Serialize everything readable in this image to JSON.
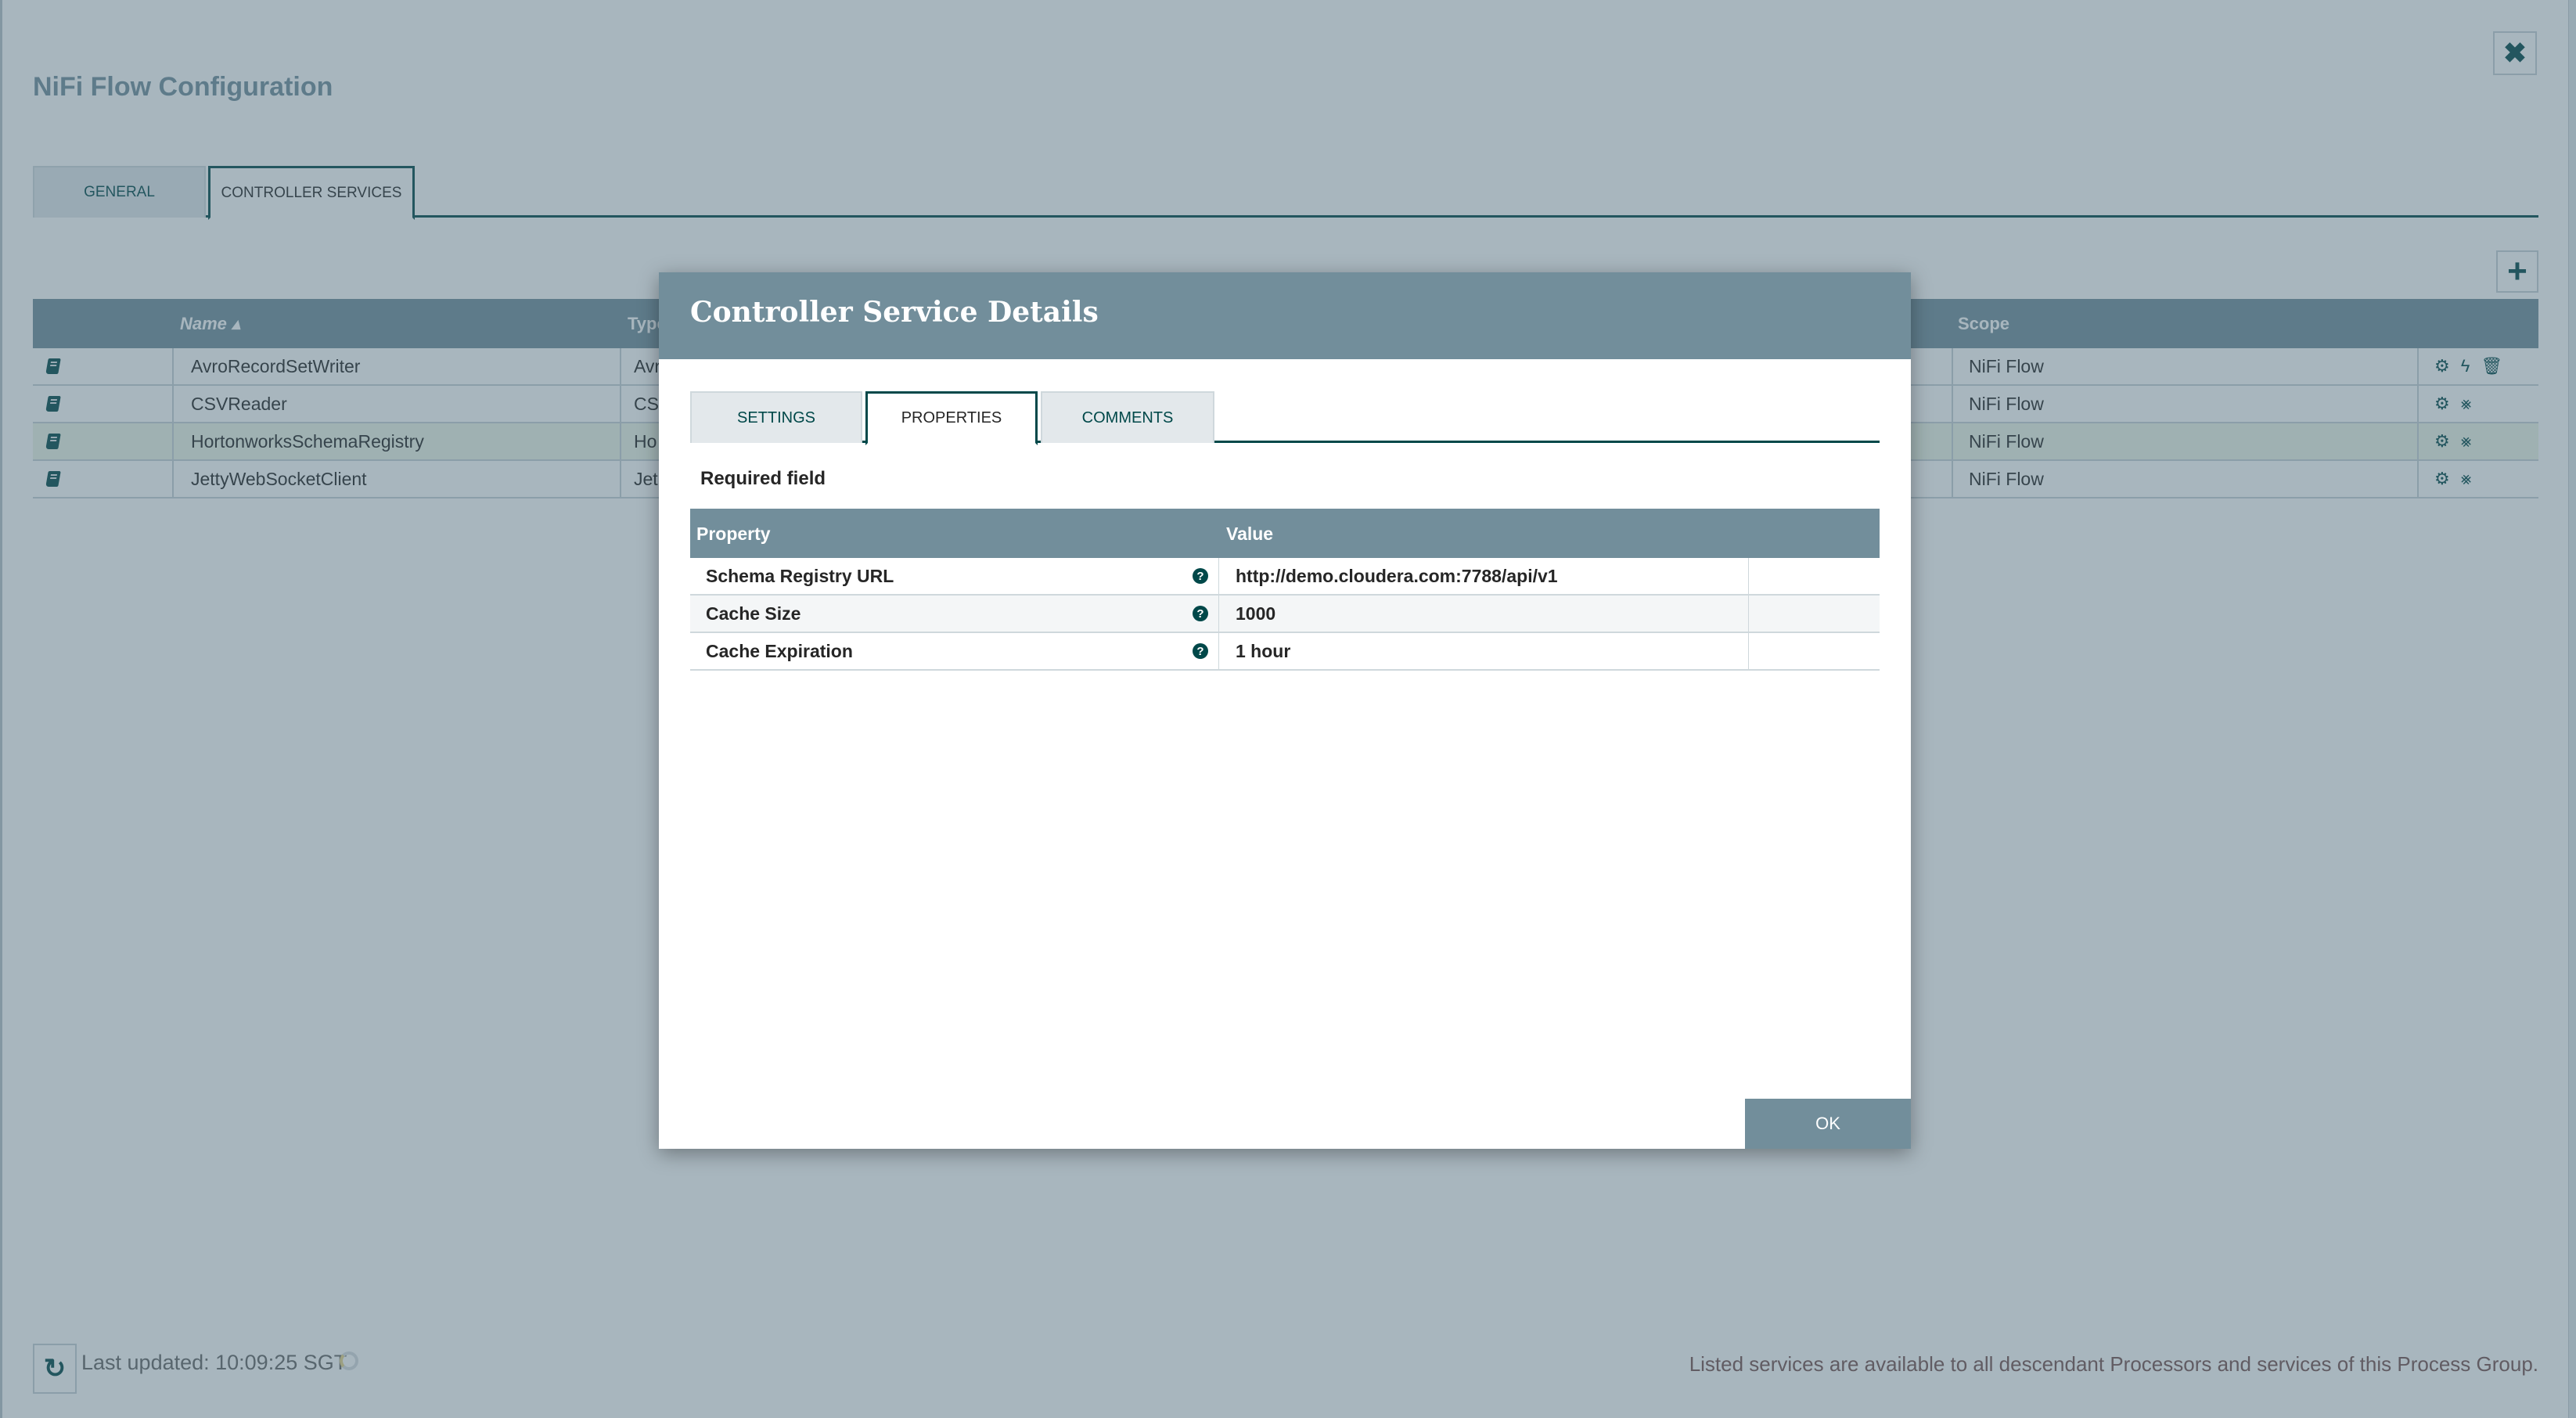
{
  "page": {
    "title": "NiFi Flow Configuration",
    "close_icon": "close-icon",
    "tabs": [
      {
        "label": "GENERAL",
        "active": false
      },
      {
        "label": "CONTROLLER SERVICES",
        "active": true
      }
    ],
    "add_button_icon": "plus-icon",
    "services_table": {
      "columns": [
        {
          "label": ""
        },
        {
          "label": "Name ▴"
        },
        {
          "label": "Type"
        },
        {
          "label": "Scope"
        },
        {
          "label": ""
        }
      ],
      "rows": [
        {
          "icon": "book-icon",
          "name": "AvroRecordSetWriter",
          "type": "Avro",
          "scope": "NiFi Flow",
          "actions": [
            "gear-icon",
            "bolt-icon",
            "trash-icon"
          ]
        },
        {
          "icon": "book-icon",
          "name": "CSVReader",
          "type": "CS",
          "scope": "NiFi Flow",
          "actions": [
            "gear-icon",
            "bolt-disabled-icon"
          ]
        },
        {
          "icon": "book-icon",
          "name": "HortonworksSchemaRegistry",
          "type": "Ho",
          "scope": "NiFi Flow",
          "actions": [
            "gear-icon",
            "bolt-disabled-icon"
          ],
          "highlighted": true
        },
        {
          "icon": "book-icon",
          "name": "JettyWebSocketClient",
          "type": "Jet",
          "scope": "NiFi Flow",
          "actions": [
            "gear-icon",
            "bolt-disabled-icon"
          ]
        }
      ]
    },
    "footer": {
      "refresh_icon": "refresh-icon",
      "last_updated": "Last updated: 10:09:25 SGT",
      "note": "Listed services are available to all descendant Processors and services of this Process Group."
    }
  },
  "dialog": {
    "title": "Controller Service Details",
    "tabs": [
      {
        "label": "SETTINGS",
        "active": false
      },
      {
        "label": "PROPERTIES",
        "active": true
      },
      {
        "label": "COMMENTS",
        "active": false
      }
    ],
    "required_label": "Required field",
    "properties_table": {
      "columns": [
        "Property",
        "Value"
      ],
      "rows": [
        {
          "property": "Schema Registry URL",
          "value": "http://demo.cloudera.com:7788/api/v1"
        },
        {
          "property": "Cache Size",
          "value": "1000"
        },
        {
          "property": "Cache Expiration",
          "value": "1 hour"
        }
      ]
    },
    "help_glyph": "?",
    "ok_label": "OK"
  },
  "colors": {
    "header_bg": "#728e9b",
    "accent": "#004849",
    "overlay": "rgba(73,102,120,0.48)"
  }
}
